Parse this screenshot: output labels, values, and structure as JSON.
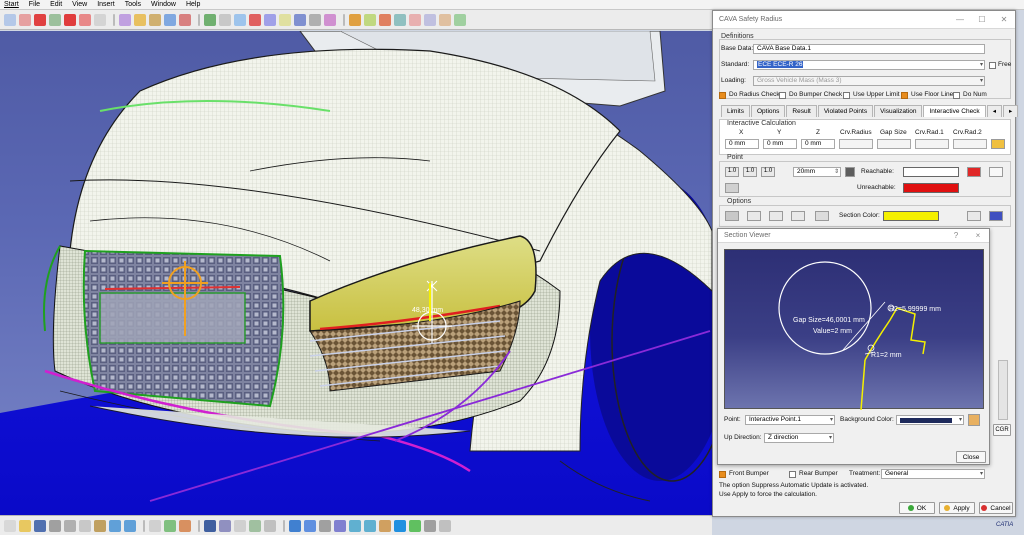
{
  "menu": [
    "Start",
    "File",
    "Edit",
    "View",
    "Insert",
    "Tools",
    "Window",
    "Help"
  ],
  "dialog": {
    "title": "CAVA Safety Radius",
    "definitions_label": "Definitions",
    "base_data_label": "Base Data:",
    "base_data_value": "CAVA Base Data.1",
    "standard_label": "Standard:",
    "standard_value": "ECE ECE-R 26",
    "free_label": "Free",
    "loading_label": "Loading:",
    "loading_value": "Gross Vehicle Mass (Mass 3)",
    "checks": {
      "radius": "Do Radius Check",
      "bumper": "Do Bumper Check",
      "upper": "Use Upper Limit",
      "floor": "Use Floor Line",
      "num": "Do Num"
    },
    "tabs": [
      "Limits",
      "Options",
      "Result",
      "Violated Points",
      "Visualization",
      "Interactive Check"
    ],
    "interactive": {
      "title": "Interactive Calculation",
      "headers": [
        "X",
        "Y",
        "Z",
        "Crv.Radius",
        "Gap Size",
        "Crv.Rad.1",
        "Crv.Rad.2"
      ],
      "x": "0 mm",
      "y": "0 mm",
      "z": "0 mm"
    },
    "point": {
      "title": "Point",
      "btn1": "1.0",
      "btn2": "1.0",
      "btn3": "1.0",
      "spin_value": "20mm",
      "reachable_label": "Reachable:",
      "unreachable_label": "Unreachable:"
    },
    "options": {
      "title": "Options",
      "section_color_label": "Section Color:"
    },
    "bottom": {
      "front_bumper": "Front Bumper",
      "rear_bumper": "Rear Bumper",
      "treatment_label": "Treatment:",
      "treatment_value": "General",
      "msg1": "The option Suppress Automatic Update is activated.",
      "msg2": "Use Apply to force the calculation.",
      "ok": "OK",
      "apply": "Apply",
      "cancel": "Cancel"
    },
    "side_btn": "CGR"
  },
  "viewer": {
    "title": "Section Viewer",
    "help": "?",
    "close_x": "×",
    "gap_text": "Gap Size=46,0001 mm",
    "value_text": "Value=2 mm",
    "r2_text": "R2=5,99999 mm",
    "r1_text": "R1=2 mm",
    "point_label": "Point:",
    "point_value": "Interactive Point.1",
    "bg_label": "Background Color:",
    "updir_label": "Up Direction:",
    "updir_value": "Z direction",
    "close_btn": "Close"
  },
  "viewport": {
    "annotation": "48,30 mm"
  },
  "brand": "CATIA",
  "colors": {
    "reachable": "#ffffff",
    "unreachable": "#e01010",
    "section": "#f4f000",
    "background": "#1e2a5c"
  }
}
